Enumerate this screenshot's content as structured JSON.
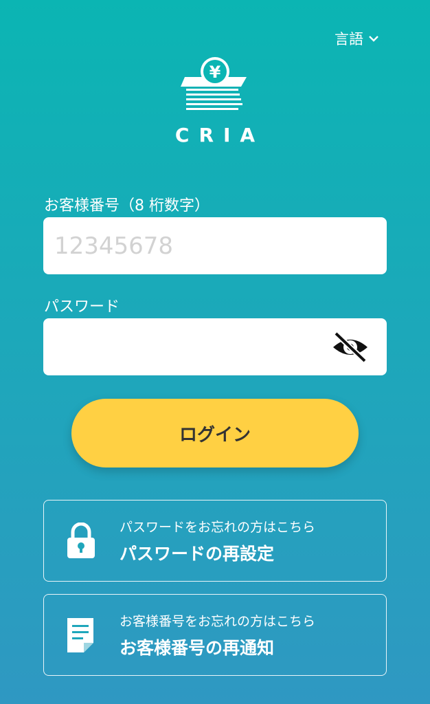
{
  "language": {
    "label": "言語",
    "icon": "chevron-down-icon"
  },
  "brand": {
    "logo_icon": "yen-coin-stack-icon",
    "name": "CRIA"
  },
  "customer_number": {
    "label": "お客様番号（8 桁数字）",
    "placeholder": "12345678",
    "value": ""
  },
  "password": {
    "label": "パスワード",
    "value": "",
    "toggle_icon": "eye-slash-icon"
  },
  "login_button": {
    "label": "ログイン",
    "color": "#ffd043"
  },
  "links": [
    {
      "icon": "lock-icon",
      "subtitle": "パスワードをお忘れの方はこちら",
      "title": "パスワードの再設定"
    },
    {
      "icon": "document-icon",
      "subtitle": "お客様番号をお忘れの方はこちら",
      "title": "お客様番号の再通知"
    }
  ],
  "colors": {
    "background_top": "#0bb5b3",
    "background_bottom": "#2f98c2",
    "accent": "#ffd043"
  }
}
